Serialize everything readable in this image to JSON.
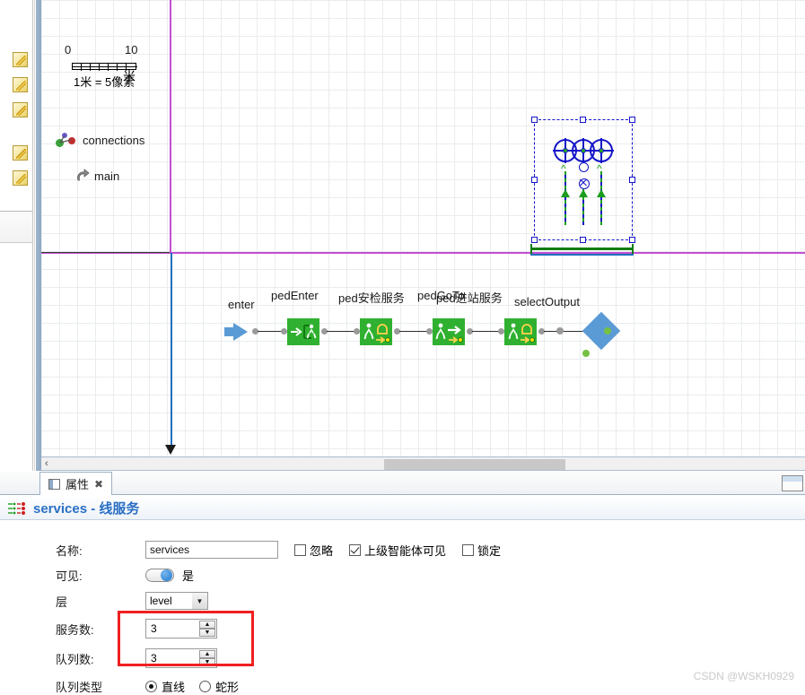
{
  "gutter": {
    "icon_name": "pencil-icon",
    "icon_count": 5
  },
  "canvas": {
    "scale": {
      "min_label": "0",
      "max_label": "10",
      "caption": "1米 = 5像素",
      "overlap_glyph": "米"
    },
    "tree": [
      {
        "label": "connections",
        "icon": "connections-icon"
      },
      {
        "label": "main",
        "icon": "main-agent-icon"
      }
    ],
    "selection": {
      "name": "line-service-object",
      "service_points": 3,
      "queue_lines": 3
    },
    "flow_blocks": [
      {
        "label": "enter",
        "icon": "source-arrow-icon"
      },
      {
        "label": "pedEnter",
        "icon": "ped-enter-icon"
      },
      {
        "label": "ped安检服务",
        "icon": "ped-service-icon"
      },
      {
        "label": "pedGoTo",
        "icon": "ped-goto-icon"
      },
      {
        "label": "ped进站服务",
        "icon": "ped-service-icon"
      },
      {
        "label": "selectOutput",
        "icon": "select-output-icon"
      }
    ],
    "scrollbar": {
      "left_arrow": "‹"
    }
  },
  "properties": {
    "tab": {
      "label": "属性",
      "close_glyph": "✖"
    },
    "title": "services - 线服务",
    "fields": {
      "name_label": "名称:",
      "name_value": "services",
      "checkboxes": [
        {
          "label": "忽略",
          "checked": false
        },
        {
          "label": "上级智能体可见",
          "checked": true
        },
        {
          "label": "锁定",
          "checked": false
        }
      ],
      "visible_label": "可见:",
      "visible_value": "是",
      "layer_label": "层",
      "layer_value": "level",
      "service_count_label": "服务数:",
      "service_count_value": "3",
      "queue_count_label": "队列数:",
      "queue_count_value": "3",
      "queue_type_label": "队列类型",
      "queue_type_options": [
        {
          "label": "直线",
          "selected": true
        },
        {
          "label": "蛇形",
          "selected": false
        }
      ]
    }
  },
  "watermark": "CSDN @WSKH0929",
  "colors": {
    "accent_blue": "#2a6fc4",
    "block_green": "#30b030",
    "axis_magenta": "#c24fd0",
    "selection_blue": "#1414c8",
    "highlight_red": "#ef2020"
  }
}
